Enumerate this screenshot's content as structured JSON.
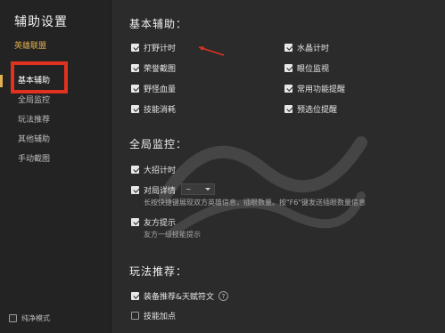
{
  "sidebar": {
    "title": "辅助设置",
    "subtitle": "英雄联盟",
    "items": [
      {
        "label": "基本辅助",
        "active": true
      },
      {
        "label": "全局监控",
        "active": false
      },
      {
        "label": "玩法推荐",
        "active": false
      },
      {
        "label": "其他辅助",
        "active": false
      },
      {
        "label": "手动截图",
        "active": false
      }
    ],
    "pure_mode": {
      "label": "纯净模式",
      "checked": false
    }
  },
  "sections": {
    "basic": {
      "title": "基本辅助：",
      "options": [
        {
          "label": "打野计时",
          "checked": true
        },
        {
          "label": "水晶计时",
          "checked": true
        },
        {
          "label": "荣誉截图",
          "checked": true
        },
        {
          "label": "眼位监视",
          "checked": true
        },
        {
          "label": "野怪血量",
          "checked": true
        },
        {
          "label": "常用功能提醒",
          "checked": true
        },
        {
          "label": "技能消耗",
          "checked": true
        },
        {
          "label": "预选位提醒",
          "checked": true
        }
      ]
    },
    "global": {
      "title": "全局监控：",
      "ult_timer": {
        "label": "大招计时",
        "checked": true
      },
      "match_detail": {
        "label": "对局详情",
        "checked": true,
        "select_value": "~",
        "description": "长按快捷键展现双方英雄信息，插眼数量。按\"F6\"键发送插眼数量信息"
      },
      "ally_tip": {
        "label": "友方提示",
        "checked": true,
        "description": "友方一级技能提示"
      }
    },
    "recommend": {
      "title": "玩法推荐：",
      "equip": {
        "label": "装备推荐&天赋符文",
        "checked": true,
        "help": "?"
      },
      "skill": {
        "label": "技能加点",
        "checked": false
      }
    }
  },
  "colors": {
    "accent": "#e3b14f",
    "highlight_box": "#e0321f",
    "background": "#2b2b2b",
    "sidebar": "#232323"
  }
}
